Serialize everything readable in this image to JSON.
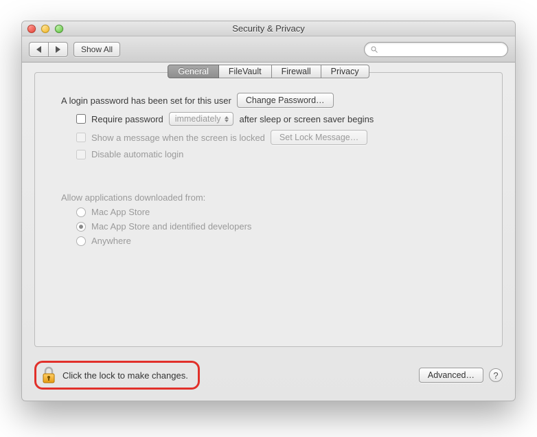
{
  "window": {
    "title": "Security & Privacy"
  },
  "toolbar": {
    "show_all": "Show All",
    "search_placeholder": ""
  },
  "tabs": [
    {
      "label": "General",
      "active": true
    },
    {
      "label": "FileVault",
      "active": false
    },
    {
      "label": "Firewall",
      "active": false
    },
    {
      "label": "Privacy",
      "active": false
    }
  ],
  "general": {
    "password_set_text": "A login password has been set for this user",
    "change_password_btn": "Change Password…",
    "require_password_label": "Require password",
    "require_password_delay": "immediately",
    "require_password_suffix": "after sleep or screen saver begins",
    "show_message_label": "Show a message when the screen is locked",
    "set_lock_message_btn": "Set Lock Message…",
    "disable_auto_login_label": "Disable automatic login",
    "gatekeeper_heading": "Allow applications downloaded from:",
    "gatekeeper_options": [
      {
        "label": "Mac App Store",
        "selected": false
      },
      {
        "label": "Mac App Store and identified developers",
        "selected": true
      },
      {
        "label": "Anywhere",
        "selected": false
      }
    ]
  },
  "footer": {
    "lock_text": "Click the lock to make changes.",
    "advanced_btn": "Advanced…",
    "help": "?"
  }
}
